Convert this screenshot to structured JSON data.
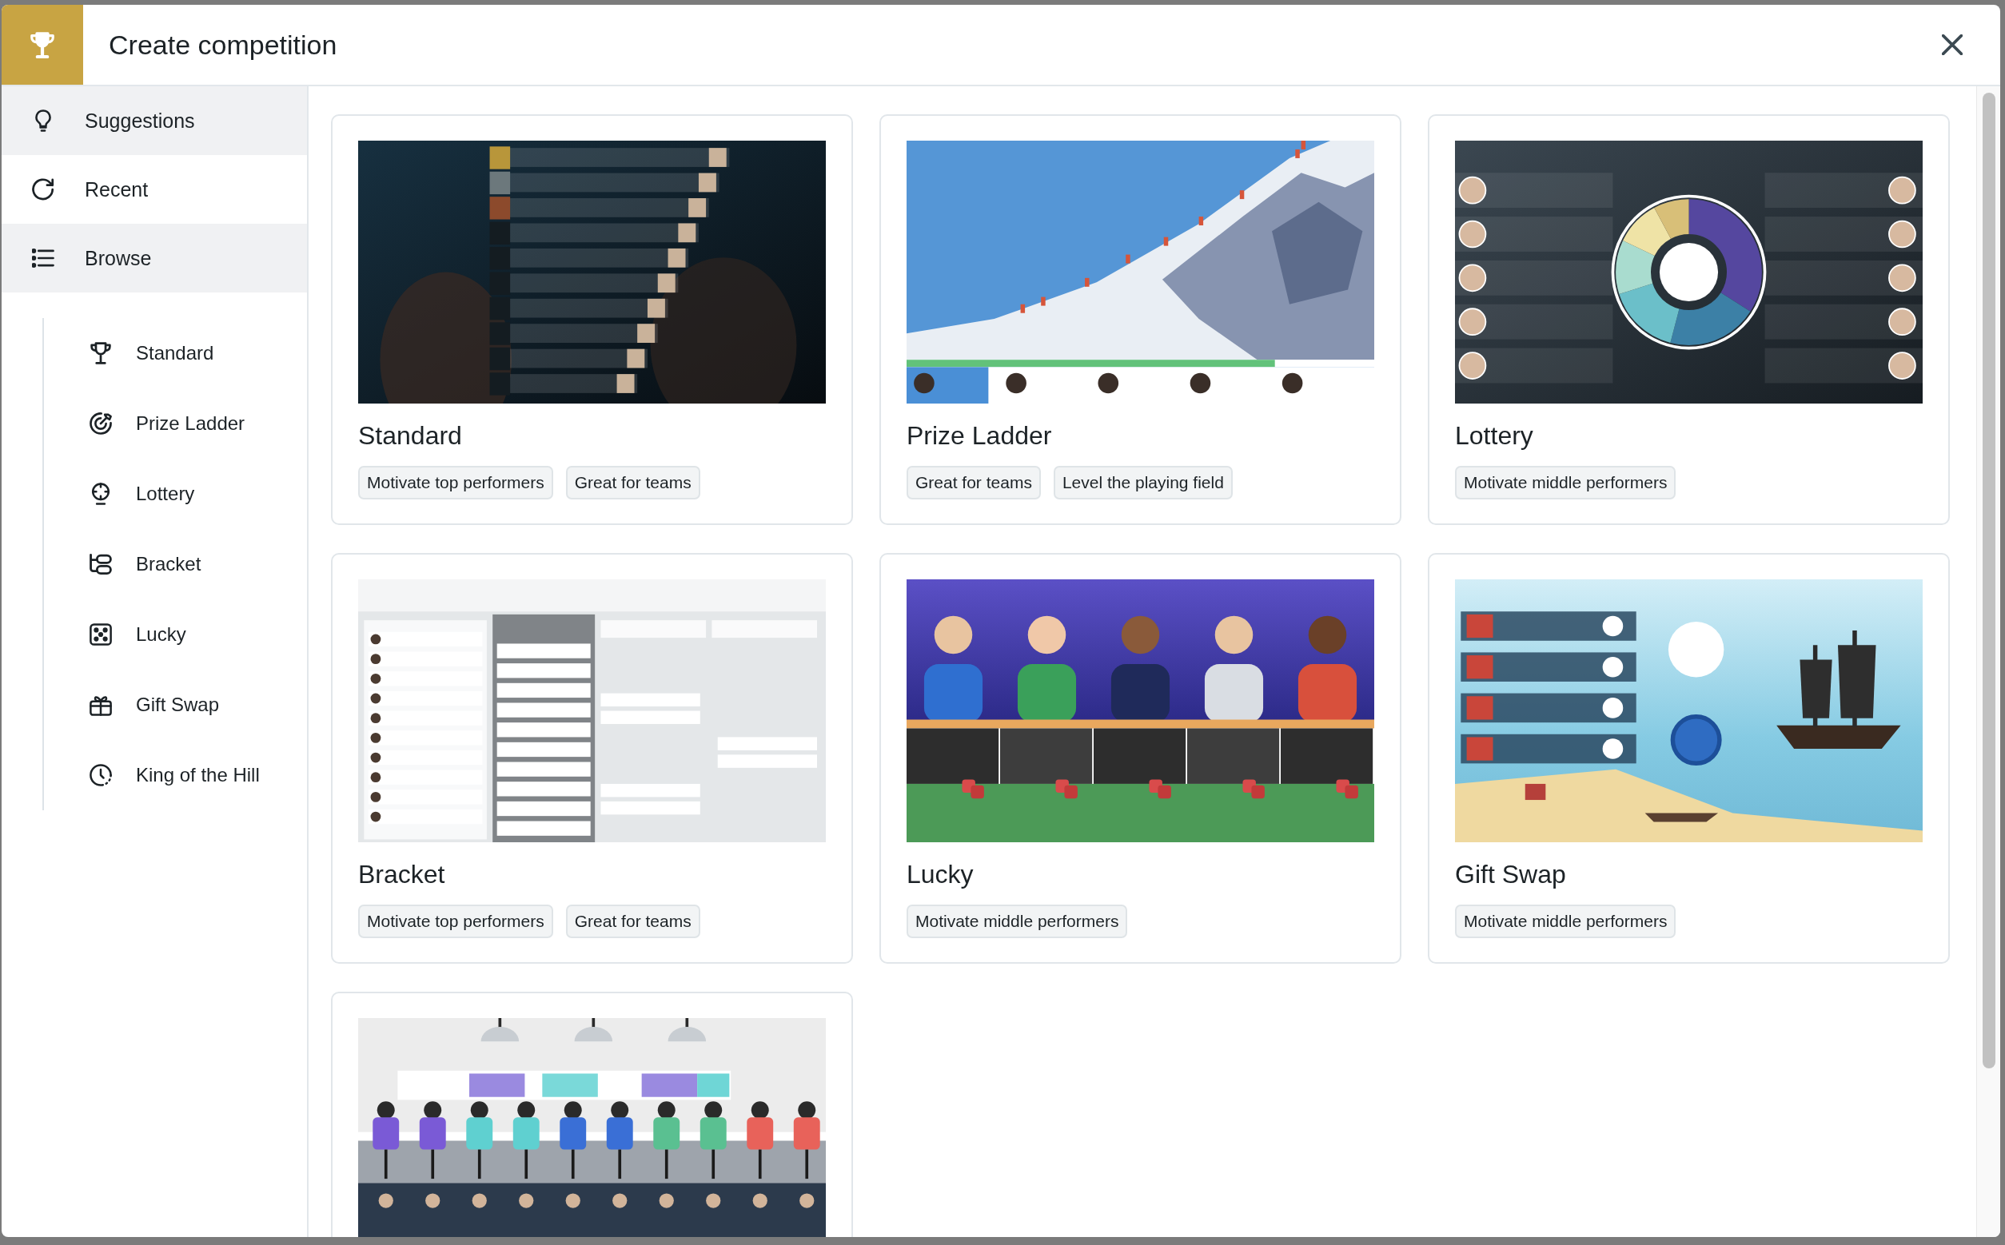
{
  "header": {
    "title": "Create competition"
  },
  "sidebar": {
    "items": [
      {
        "label": "Suggestions",
        "selected": true
      },
      {
        "label": "Recent",
        "selected": false
      },
      {
        "label": "Browse",
        "selected": true,
        "children": [
          {
            "label": "Standard",
            "selected": false
          },
          {
            "label": "Prize Ladder",
            "selected": false
          },
          {
            "label": "Lottery",
            "selected": false
          },
          {
            "label": "Bracket",
            "selected": false
          },
          {
            "label": "Lucky",
            "selected": false
          },
          {
            "label": "Gift Swap",
            "selected": false
          },
          {
            "label": "King of the Hill",
            "selected": false
          }
        ]
      }
    ]
  },
  "cards": [
    {
      "kind": "leaderboard",
      "title": "Standard",
      "tags": [
        "Motivate top performers",
        "Great for teams"
      ]
    },
    {
      "kind": "mountain",
      "title": "Prize Ladder",
      "tags": [
        "Great for teams",
        "Level the playing field"
      ]
    },
    {
      "kind": "wheel",
      "title": "Lottery",
      "tags": [
        "Motivate middle performers"
      ]
    },
    {
      "kind": "bracket",
      "title": "Bracket",
      "tags": [
        "Motivate top performers",
        "Great for teams"
      ]
    },
    {
      "kind": "dice",
      "title": "Lucky",
      "tags": [
        "Motivate middle performers"
      ]
    },
    {
      "kind": "ship",
      "title": "Gift Swap",
      "tags": [
        "Motivate middle performers"
      ]
    },
    {
      "kind": "office"
    }
  ]
}
